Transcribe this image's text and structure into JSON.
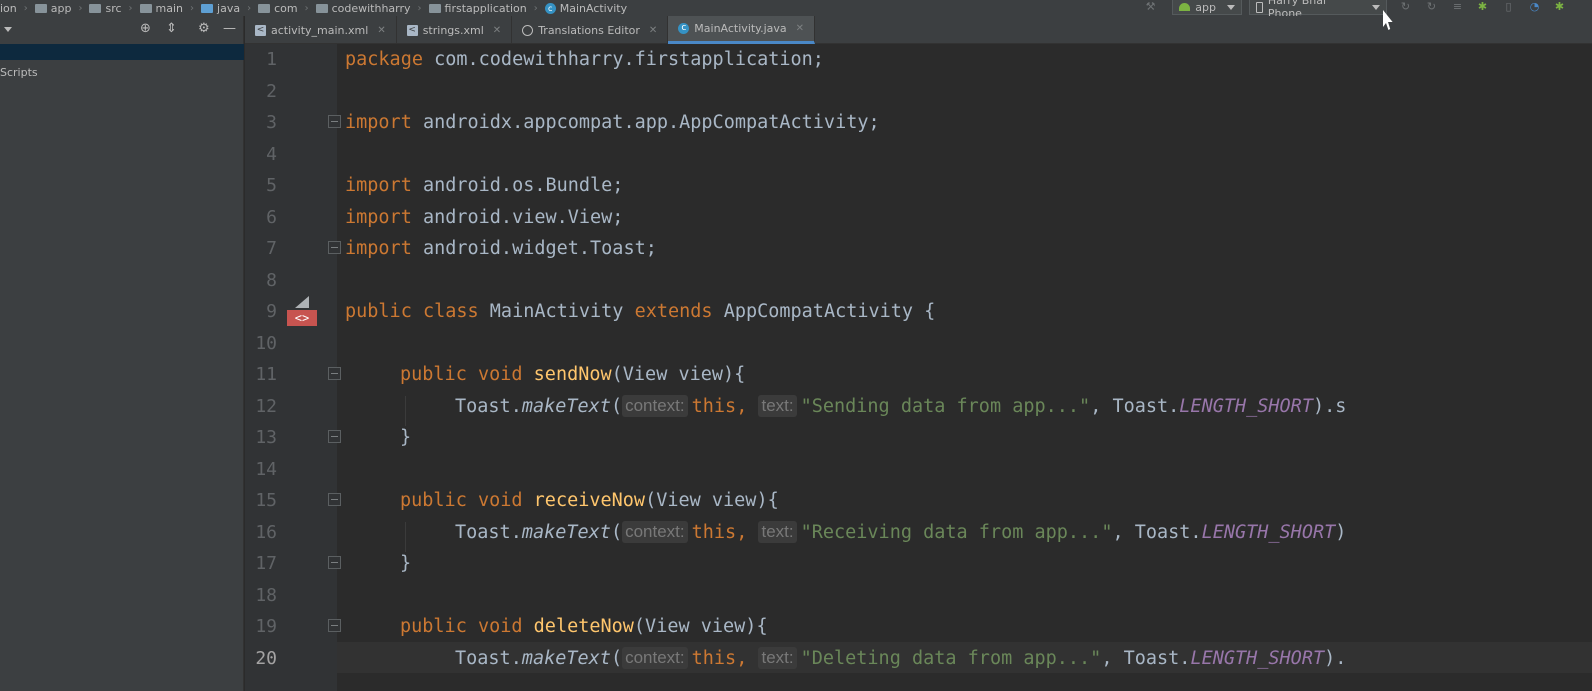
{
  "breadcrumb": [
    {
      "label": "ion",
      "icon": "none"
    },
    {
      "label": "app",
      "icon": "module-folder-icon"
    },
    {
      "label": "src",
      "icon": "folder-icon"
    },
    {
      "label": "main",
      "icon": "folder-icon"
    },
    {
      "label": "java",
      "icon": "source-folder-icon"
    },
    {
      "label": "com",
      "icon": "package-folder-icon"
    },
    {
      "label": "codewithharry",
      "icon": "package-folder-icon"
    },
    {
      "label": "firstapplication",
      "icon": "package-folder-icon"
    },
    {
      "label": "MainActivity",
      "icon": "class-icon"
    }
  ],
  "toolbar": {
    "run_config": "app",
    "device": "Harry Bhai Phone"
  },
  "left_panel": {
    "scripts_label": "Scripts"
  },
  "tabs": [
    {
      "label": "activity_main.xml",
      "icon": "xml-file-icon",
      "active": false
    },
    {
      "label": "strings.xml",
      "icon": "xml-file-icon",
      "active": false
    },
    {
      "label": "Translations Editor",
      "icon": "globe-icon",
      "active": false
    },
    {
      "label": "MainActivity.java",
      "icon": "java-class-icon",
      "active": true
    }
  ],
  "editor": {
    "line_numbers": [
      "1",
      "2",
      "3",
      "4",
      "5",
      "6",
      "7",
      "8",
      "9",
      "10",
      "11",
      "12",
      "13",
      "14",
      "15",
      "16",
      "17",
      "18",
      "19",
      "20"
    ],
    "current_line": 20,
    "lines": {
      "l1": {
        "kw": "package",
        "rest": " com.codewithharry.firstapplication;"
      },
      "l3": {
        "kw": "import",
        "rest": " androidx.appcompat.app.AppCompatActivity;"
      },
      "l5": {
        "kw": "import",
        "rest": " android.os.Bundle;"
      },
      "l6": {
        "kw": "import",
        "rest": " android.view.View;"
      },
      "l7": {
        "kw": "import",
        "rest": " android.widget.Toast;"
      },
      "l9": {
        "kw1": "public class",
        "name": " MainActivity ",
        "kw2": "extends",
        "rest": " AppCompatActivity {"
      },
      "l11": {
        "kw": "public void",
        "method": "sendNow",
        "rest": "(View view){"
      },
      "l12": {
        "pre": "Toast.",
        "call": "makeText",
        "paren": "(",
        "hint1": "context:",
        "this": "this",
        "comma": ",",
        "hint2": "text:",
        "str": "\"Sending data from app...\"",
        "post": ", Toast.",
        "const": "LENGTH_SHORT",
        "tail": ").s"
      },
      "l13": {
        "text": "}"
      },
      "l15": {
        "kw": "public void",
        "method": "receiveNow",
        "rest": "(View view){"
      },
      "l16": {
        "pre": "Toast.",
        "call": "makeText",
        "paren": "(",
        "hint1": "context:",
        "this": "this",
        "comma": ",",
        "hint2": "text:",
        "str": "\"Receiving data from app...\"",
        "post": ", Toast.",
        "const": "LENGTH_SHORT",
        "tail": ")"
      },
      "l17": {
        "text": "}"
      },
      "l19": {
        "kw": "public void",
        "method": "deleteNow",
        "rest": "(View view){"
      },
      "l20": {
        "pre": "Toast.",
        "call": "makeText",
        "paren": "(",
        "hint1": "context:",
        "this": "this",
        "comma": ",",
        "hint2": "text:",
        "str": "\"Deleting data from app...\"",
        "post": ", Toast.",
        "const": "LENGTH_SHORT",
        "tail": ")."
      }
    }
  },
  "colors": {
    "keyword": "#cc7832",
    "string": "#6a8759",
    "method_decl": "#ffc66d",
    "constant": "#9876aa",
    "background": "#2b2b2b"
  }
}
